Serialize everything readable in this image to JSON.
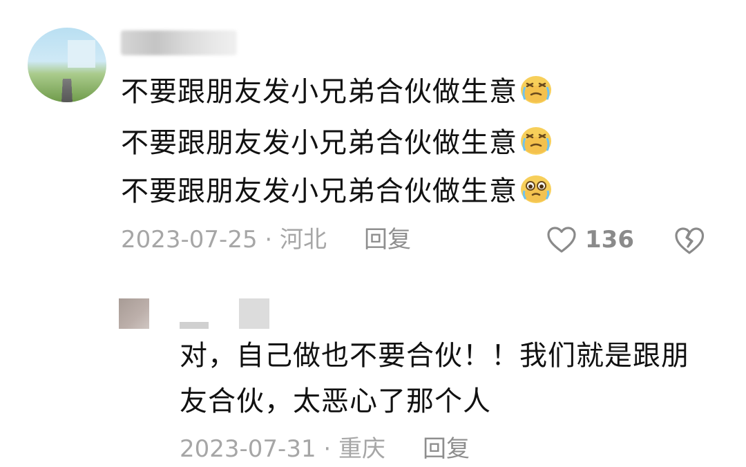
{
  "comment": {
    "lines": [
      "不要跟朋友发小兄弟合伙做生意",
      "不要跟朋友发小兄弟合伙做生意",
      "不要跟朋友发小兄弟合伙做生意"
    ],
    "emoji_icons": [
      "crying-face-emoji",
      "crying-face-emoji",
      "pleading-face-emoji"
    ],
    "date_location": "2023-07-25 · 河北",
    "reply_label": "回复",
    "like_count": "136"
  },
  "reply": {
    "text": "对，自己做也不要合伙！！我们就是跟朋友合伙，太恶心了那个人",
    "date_location": "2023-07-31 · 重庆",
    "reply_label": "回复"
  }
}
